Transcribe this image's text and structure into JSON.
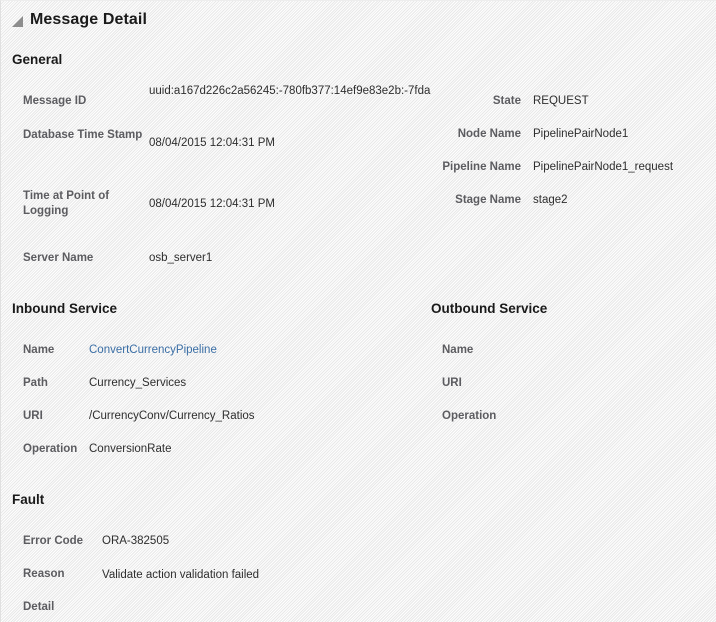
{
  "panel": {
    "title": "Message Detail",
    "disclosure_icon": "triangle-collapse-icon"
  },
  "sections": {
    "general": {
      "heading": "General",
      "left_fields": [
        {
          "label": "Message ID",
          "value": "uuid:a167d226c2a56245:-780fb377:14ef9e83e2b:-7fda"
        },
        {
          "label": "Database Time Stamp",
          "value": "08/04/2015 12:04:31 PM"
        },
        {
          "label": "Time at Point of Logging",
          "value": "08/04/2015 12:04:31 PM"
        },
        {
          "label": "Server Name",
          "value": "osb_server1"
        }
      ],
      "right_fields": [
        {
          "label": "State",
          "value": "REQUEST"
        },
        {
          "label": "Node Name",
          "value": "PipelinePairNode1"
        },
        {
          "label": "Pipeline Name",
          "value": "PipelinePairNode1_request"
        },
        {
          "label": "Stage Name",
          "value": "stage2"
        }
      ]
    },
    "inbound_service": {
      "heading": "Inbound Service",
      "fields": [
        {
          "label": "Name",
          "value": "ConvertCurrencyPipeline",
          "is_link": true
        },
        {
          "label": "Path",
          "value": "Currency_Services",
          "is_link": false
        },
        {
          "label": "URI",
          "value": "/CurrencyConv/Currency_Ratios",
          "is_link": false
        },
        {
          "label": "Operation",
          "value": "ConversionRate",
          "is_link": false
        }
      ]
    },
    "outbound_service": {
      "heading": "Outbound Service",
      "fields": [
        {
          "label": "Name",
          "value": ""
        },
        {
          "label": "URI",
          "value": ""
        },
        {
          "label": "Operation",
          "value": ""
        }
      ]
    },
    "fault": {
      "heading": "Fault",
      "fields": [
        {
          "label": "Error Code",
          "value": "ORA-382505"
        },
        {
          "label": "Reason",
          "value": "Validate action validation failed"
        },
        {
          "label": "Detail",
          "value": ""
        }
      ]
    }
  },
  "colors": {
    "link": "#3a6ea5",
    "label": "#5c5c60",
    "value": "#2e2e2e",
    "heading": "#1a1a1a",
    "background": "#f4f4f4"
  }
}
